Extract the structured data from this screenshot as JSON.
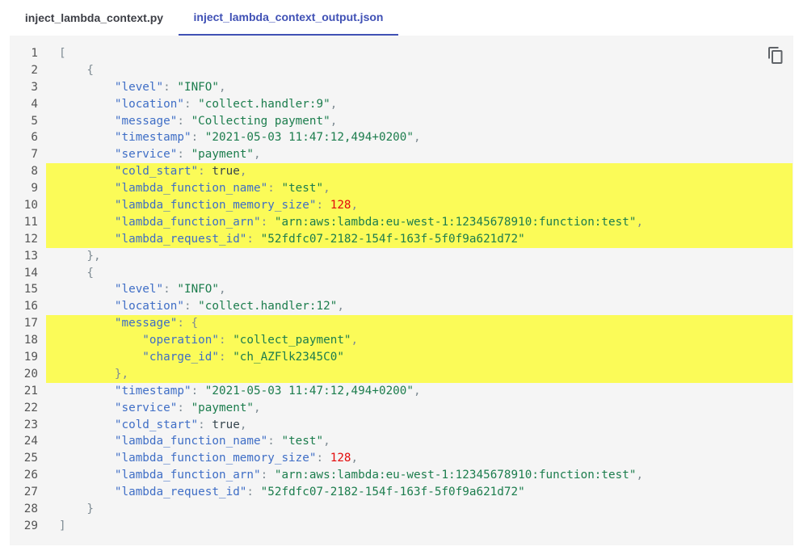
{
  "tabs": [
    {
      "label": "inject_lambda_context.py",
      "active": false
    },
    {
      "label": "inject_lambda_context_output.json",
      "active": true
    }
  ],
  "copy_button": {
    "icon": "copy-icon"
  },
  "colors": {
    "accent": "#4051b5",
    "highlight": "#fbfb58",
    "key": "#3f6ec6",
    "string": "#1c7d4d",
    "number": "#e30b0b"
  },
  "highlighted_lines": [
    8,
    9,
    10,
    11,
    12,
    17,
    18,
    19,
    20
  ],
  "code_lines": [
    {
      "num": "1",
      "tokens": [
        {
          "t": "[",
          "c": "pun"
        }
      ]
    },
    {
      "num": "2",
      "tokens": [
        {
          "t": "    {",
          "c": "pun"
        }
      ]
    },
    {
      "num": "3",
      "tokens": [
        {
          "t": "        ",
          "c": "pun"
        },
        {
          "t": "\"level\"",
          "c": "key"
        },
        {
          "t": ": ",
          "c": "pun"
        },
        {
          "t": "\"INFO\"",
          "c": "str"
        },
        {
          "t": ",",
          "c": "pun"
        }
      ]
    },
    {
      "num": "4",
      "tokens": [
        {
          "t": "        ",
          "c": "pun"
        },
        {
          "t": "\"location\"",
          "c": "key"
        },
        {
          "t": ": ",
          "c": "pun"
        },
        {
          "t": "\"collect.handler:9\"",
          "c": "str"
        },
        {
          "t": ",",
          "c": "pun"
        }
      ]
    },
    {
      "num": "5",
      "tokens": [
        {
          "t": "        ",
          "c": "pun"
        },
        {
          "t": "\"message\"",
          "c": "key"
        },
        {
          "t": ": ",
          "c": "pun"
        },
        {
          "t": "\"Collecting payment\"",
          "c": "str"
        },
        {
          "t": ",",
          "c": "pun"
        }
      ]
    },
    {
      "num": "6",
      "tokens": [
        {
          "t": "        ",
          "c": "pun"
        },
        {
          "t": "\"timestamp\"",
          "c": "key"
        },
        {
          "t": ": ",
          "c": "pun"
        },
        {
          "t": "\"2021-05-03 11:47:12,494+0200\"",
          "c": "str"
        },
        {
          "t": ",",
          "c": "pun"
        }
      ]
    },
    {
      "num": "7",
      "tokens": [
        {
          "t": "        ",
          "c": "pun"
        },
        {
          "t": "\"service\"",
          "c": "key"
        },
        {
          "t": ": ",
          "c": "pun"
        },
        {
          "t": "\"payment\"",
          "c": "str"
        },
        {
          "t": ",",
          "c": "pun"
        }
      ]
    },
    {
      "num": "8",
      "tokens": [
        {
          "t": "        ",
          "c": "pun"
        },
        {
          "t": "\"cold_start\"",
          "c": "key"
        },
        {
          "t": ": ",
          "c": "pun"
        },
        {
          "t": "true",
          "c": "bool"
        },
        {
          "t": ",",
          "c": "pun"
        }
      ]
    },
    {
      "num": "9",
      "tokens": [
        {
          "t": "        ",
          "c": "pun"
        },
        {
          "t": "\"lambda_function_name\"",
          "c": "key"
        },
        {
          "t": ": ",
          "c": "pun"
        },
        {
          "t": "\"test\"",
          "c": "str"
        },
        {
          "t": ",",
          "c": "pun"
        }
      ]
    },
    {
      "num": "10",
      "tokens": [
        {
          "t": "        ",
          "c": "pun"
        },
        {
          "t": "\"lambda_function_memory_size\"",
          "c": "key"
        },
        {
          "t": ": ",
          "c": "pun"
        },
        {
          "t": "128",
          "c": "num"
        },
        {
          "t": ",",
          "c": "pun"
        }
      ]
    },
    {
      "num": "11",
      "tokens": [
        {
          "t": "        ",
          "c": "pun"
        },
        {
          "t": "\"lambda_function_arn\"",
          "c": "key"
        },
        {
          "t": ": ",
          "c": "pun"
        },
        {
          "t": "\"arn:aws:lambda:eu-west-1:12345678910:function:test\"",
          "c": "str"
        },
        {
          "t": ",",
          "c": "pun"
        }
      ]
    },
    {
      "num": "12",
      "tokens": [
        {
          "t": "        ",
          "c": "pun"
        },
        {
          "t": "\"lambda_request_id\"",
          "c": "key"
        },
        {
          "t": ": ",
          "c": "pun"
        },
        {
          "t": "\"52fdfc07-2182-154f-163f-5f0f9a621d72\"",
          "c": "str"
        }
      ]
    },
    {
      "num": "13",
      "tokens": [
        {
          "t": "    },",
          "c": "pun"
        }
      ]
    },
    {
      "num": "14",
      "tokens": [
        {
          "t": "    {",
          "c": "pun"
        }
      ]
    },
    {
      "num": "15",
      "tokens": [
        {
          "t": "        ",
          "c": "pun"
        },
        {
          "t": "\"level\"",
          "c": "key"
        },
        {
          "t": ": ",
          "c": "pun"
        },
        {
          "t": "\"INFO\"",
          "c": "str"
        },
        {
          "t": ",",
          "c": "pun"
        }
      ]
    },
    {
      "num": "16",
      "tokens": [
        {
          "t": "        ",
          "c": "pun"
        },
        {
          "t": "\"location\"",
          "c": "key"
        },
        {
          "t": ": ",
          "c": "pun"
        },
        {
          "t": "\"collect.handler:12\"",
          "c": "str"
        },
        {
          "t": ",",
          "c": "pun"
        }
      ]
    },
    {
      "num": "17",
      "tokens": [
        {
          "t": "        ",
          "c": "pun"
        },
        {
          "t": "\"message\"",
          "c": "key"
        },
        {
          "t": ": {",
          "c": "pun"
        }
      ]
    },
    {
      "num": "18",
      "tokens": [
        {
          "t": "            ",
          "c": "pun"
        },
        {
          "t": "\"operation\"",
          "c": "key"
        },
        {
          "t": ": ",
          "c": "pun"
        },
        {
          "t": "\"collect_payment\"",
          "c": "str"
        },
        {
          "t": ",",
          "c": "pun"
        }
      ]
    },
    {
      "num": "19",
      "tokens": [
        {
          "t": "            ",
          "c": "pun"
        },
        {
          "t": "\"charge_id\"",
          "c": "key"
        },
        {
          "t": ": ",
          "c": "pun"
        },
        {
          "t": "\"ch_AZFlk2345C0\"",
          "c": "str"
        }
      ]
    },
    {
      "num": "20",
      "tokens": [
        {
          "t": "        },",
          "c": "pun"
        }
      ]
    },
    {
      "num": "21",
      "tokens": [
        {
          "t": "        ",
          "c": "pun"
        },
        {
          "t": "\"timestamp\"",
          "c": "key"
        },
        {
          "t": ": ",
          "c": "pun"
        },
        {
          "t": "\"2021-05-03 11:47:12,494+0200\"",
          "c": "str"
        },
        {
          "t": ",",
          "c": "pun"
        }
      ]
    },
    {
      "num": "22",
      "tokens": [
        {
          "t": "        ",
          "c": "pun"
        },
        {
          "t": "\"service\"",
          "c": "key"
        },
        {
          "t": ": ",
          "c": "pun"
        },
        {
          "t": "\"payment\"",
          "c": "str"
        },
        {
          "t": ",",
          "c": "pun"
        }
      ]
    },
    {
      "num": "23",
      "tokens": [
        {
          "t": "        ",
          "c": "pun"
        },
        {
          "t": "\"cold_start\"",
          "c": "key"
        },
        {
          "t": ": ",
          "c": "pun"
        },
        {
          "t": "true",
          "c": "bool"
        },
        {
          "t": ",",
          "c": "pun"
        }
      ]
    },
    {
      "num": "24",
      "tokens": [
        {
          "t": "        ",
          "c": "pun"
        },
        {
          "t": "\"lambda_function_name\"",
          "c": "key"
        },
        {
          "t": ": ",
          "c": "pun"
        },
        {
          "t": "\"test\"",
          "c": "str"
        },
        {
          "t": ",",
          "c": "pun"
        }
      ]
    },
    {
      "num": "25",
      "tokens": [
        {
          "t": "        ",
          "c": "pun"
        },
        {
          "t": "\"lambda_function_memory_size\"",
          "c": "key"
        },
        {
          "t": ": ",
          "c": "pun"
        },
        {
          "t": "128",
          "c": "num"
        },
        {
          "t": ",",
          "c": "pun"
        }
      ]
    },
    {
      "num": "26",
      "tokens": [
        {
          "t": "        ",
          "c": "pun"
        },
        {
          "t": "\"lambda_function_arn\"",
          "c": "key"
        },
        {
          "t": ": ",
          "c": "pun"
        },
        {
          "t": "\"arn:aws:lambda:eu-west-1:12345678910:function:test\"",
          "c": "str"
        },
        {
          "t": ",",
          "c": "pun"
        }
      ]
    },
    {
      "num": "27",
      "tokens": [
        {
          "t": "        ",
          "c": "pun"
        },
        {
          "t": "\"lambda_request_id\"",
          "c": "key"
        },
        {
          "t": ": ",
          "c": "pun"
        },
        {
          "t": "\"52fdfc07-2182-154f-163f-5f0f9a621d72\"",
          "c": "str"
        }
      ]
    },
    {
      "num": "28",
      "tokens": [
        {
          "t": "    }",
          "c": "pun"
        }
      ]
    },
    {
      "num": "29",
      "tokens": [
        {
          "t": "]",
          "c": "pun"
        }
      ]
    }
  ]
}
